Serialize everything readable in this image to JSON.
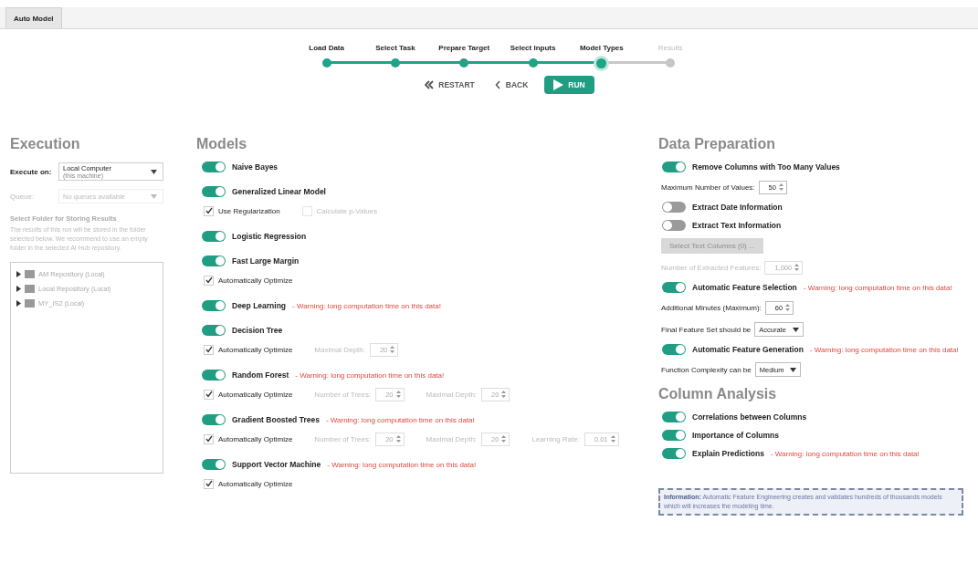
{
  "tabs": [
    {
      "label": "Auto Model",
      "selected": true
    }
  ],
  "stepper": {
    "steps": [
      {
        "label": "Load Data",
        "done": true,
        "selected": false
      },
      {
        "label": "Select Task",
        "done": true,
        "selected": false
      },
      {
        "label": "Prepare Target",
        "done": true,
        "selected": false
      },
      {
        "label": "Select Inputs",
        "done": true,
        "selected": false
      },
      {
        "label": "Model Types",
        "done": true,
        "selected": true
      },
      {
        "label": "Results",
        "done": false,
        "selected": false
      }
    ],
    "buttons": [
      {
        "kind": "restart",
        "label": "RESTART"
      },
      {
        "kind": "back",
        "label": "BACK"
      },
      {
        "kind": "run",
        "label": "RUN"
      }
    ]
  },
  "execution": {
    "title": "Execution",
    "execute_on": {
      "label": "Execute on:",
      "value": "Local Computer",
      "sub": "(this machine)"
    },
    "queue": {
      "label": "Queue:",
      "placeholder": "No queues available",
      "disabled": true
    },
    "folder_title": "Select Folder for Storing Results",
    "folder_text": "The results of this run will be stored in the folder selected below. We recommend to use an empty folder in the selected AI Hub repository.",
    "tree": [
      {
        "name": "AM Repository",
        "tag": "(Local)"
      },
      {
        "name": "Local Repository",
        "tag": "(Local)"
      },
      {
        "name": "MY_IS2",
        "tag": "(Local)"
      }
    ]
  },
  "models": {
    "title": "Models",
    "items": [
      {
        "name": "Naive Bayes",
        "on": true
      },
      {
        "name": "Generalized Linear Model",
        "on": true,
        "options": [
          {
            "kind": "checkbox",
            "label": "Use Regularization",
            "checked": true,
            "disabled": false
          },
          {
            "kind": "checkbox",
            "label": "Calculate p-Values",
            "checked": false,
            "disabled": true
          }
        ]
      },
      {
        "name": "Logistic Regression",
        "on": true
      },
      {
        "name": "Fast Large Margin",
        "on": true,
        "options": [
          {
            "kind": "checkbox",
            "label": "Automatically Optimize",
            "checked": true,
            "disabled": false
          }
        ]
      },
      {
        "name": "Deep Learning",
        "on": true,
        "warning": "- Warning: long computation time on this data!"
      },
      {
        "name": "Decision Tree",
        "on": true,
        "options": [
          {
            "kind": "checkbox",
            "label": "Automatically Optimize",
            "checked": true,
            "disabled": false
          },
          {
            "kind": "spinner",
            "label": "Maximal Depth:",
            "value": "20",
            "disabled": true
          }
        ]
      },
      {
        "name": "Random Forest",
        "on": true,
        "warning": "- Warning: long computation time on this data!",
        "options": [
          {
            "kind": "checkbox",
            "label": "Automatically Optimize",
            "checked": true,
            "disabled": false
          },
          {
            "kind": "spinner",
            "label": "Number of Trees:",
            "value": "20",
            "disabled": true
          },
          {
            "kind": "spinner",
            "label": "Maximal Depth:",
            "value": "20",
            "disabled": true
          }
        ]
      },
      {
        "name": "Gradient Boosted Trees",
        "on": true,
        "warning": "- Warning: long computation time on this data!",
        "options": [
          {
            "kind": "checkbox",
            "label": "Automatically Optimize",
            "checked": true,
            "disabled": false
          },
          {
            "kind": "spinner",
            "label": "Number of Trees:",
            "value": "20",
            "disabled": true
          },
          {
            "kind": "spinner",
            "label": "Maximal Depth:",
            "value": "20",
            "disabled": true
          },
          {
            "kind": "spinner",
            "label": "Learning Rate:",
            "value": "0.01",
            "disabled": true
          }
        ]
      },
      {
        "name": "Support Vector Machine",
        "on": true,
        "warning": "- Warning: long computation time on this data!",
        "options": [
          {
            "kind": "checkbox",
            "label": "Automatically Optimize",
            "checked": true,
            "disabled": false
          }
        ]
      }
    ]
  },
  "data_preparation": {
    "title": "Data Preparation",
    "items": [
      {
        "kind": "toggle",
        "label": "Remove Columns with Too Many Values",
        "on": true
      },
      {
        "kind": "spinner",
        "label": "Maximum Number of Values:",
        "value": "50",
        "disabled": false
      },
      {
        "kind": "toggle",
        "label": "Extract Date Information",
        "on": false
      },
      {
        "kind": "toggle",
        "label": "Extract Text Information",
        "on": false
      },
      {
        "kind": "button",
        "label": "Select Text Columns (0) ...",
        "disabled": true
      },
      {
        "kind": "spinner",
        "label": "Number of Extracted Features:",
        "value": "1,000",
        "disabled": true
      },
      {
        "kind": "toggle",
        "label": "Automatic Feature Selection",
        "on": true,
        "warning": "- Warning: long computation time on this data!"
      },
      {
        "kind": "spinner",
        "label": "Additional Minutes (Maximum):",
        "value": "60",
        "disabled": false
      },
      {
        "kind": "select",
        "label": "Final Feature Set should be",
        "value": "Accurate"
      },
      {
        "kind": "toggle",
        "label": "Automatic Feature Generation",
        "on": true,
        "warning": "- Warning: long computation time on this data!"
      },
      {
        "kind": "select",
        "label": "Function Complexity can be",
        "value": "Medium"
      }
    ]
  },
  "column_analysis": {
    "title": "Column Analysis",
    "items": [
      {
        "kind": "toggle",
        "label": "Correlations between Columns",
        "on": true
      },
      {
        "kind": "toggle",
        "label": "Importance of Columns",
        "on": true
      },
      {
        "kind": "toggle",
        "label": "Explain Predictions",
        "on": true,
        "warning": "- Warning: long computation time on this data!"
      }
    ]
  },
  "info": "**Information:** Automatic Feature Engineering creates and validates hundreds of thousands models which will increases the modeling time."
}
